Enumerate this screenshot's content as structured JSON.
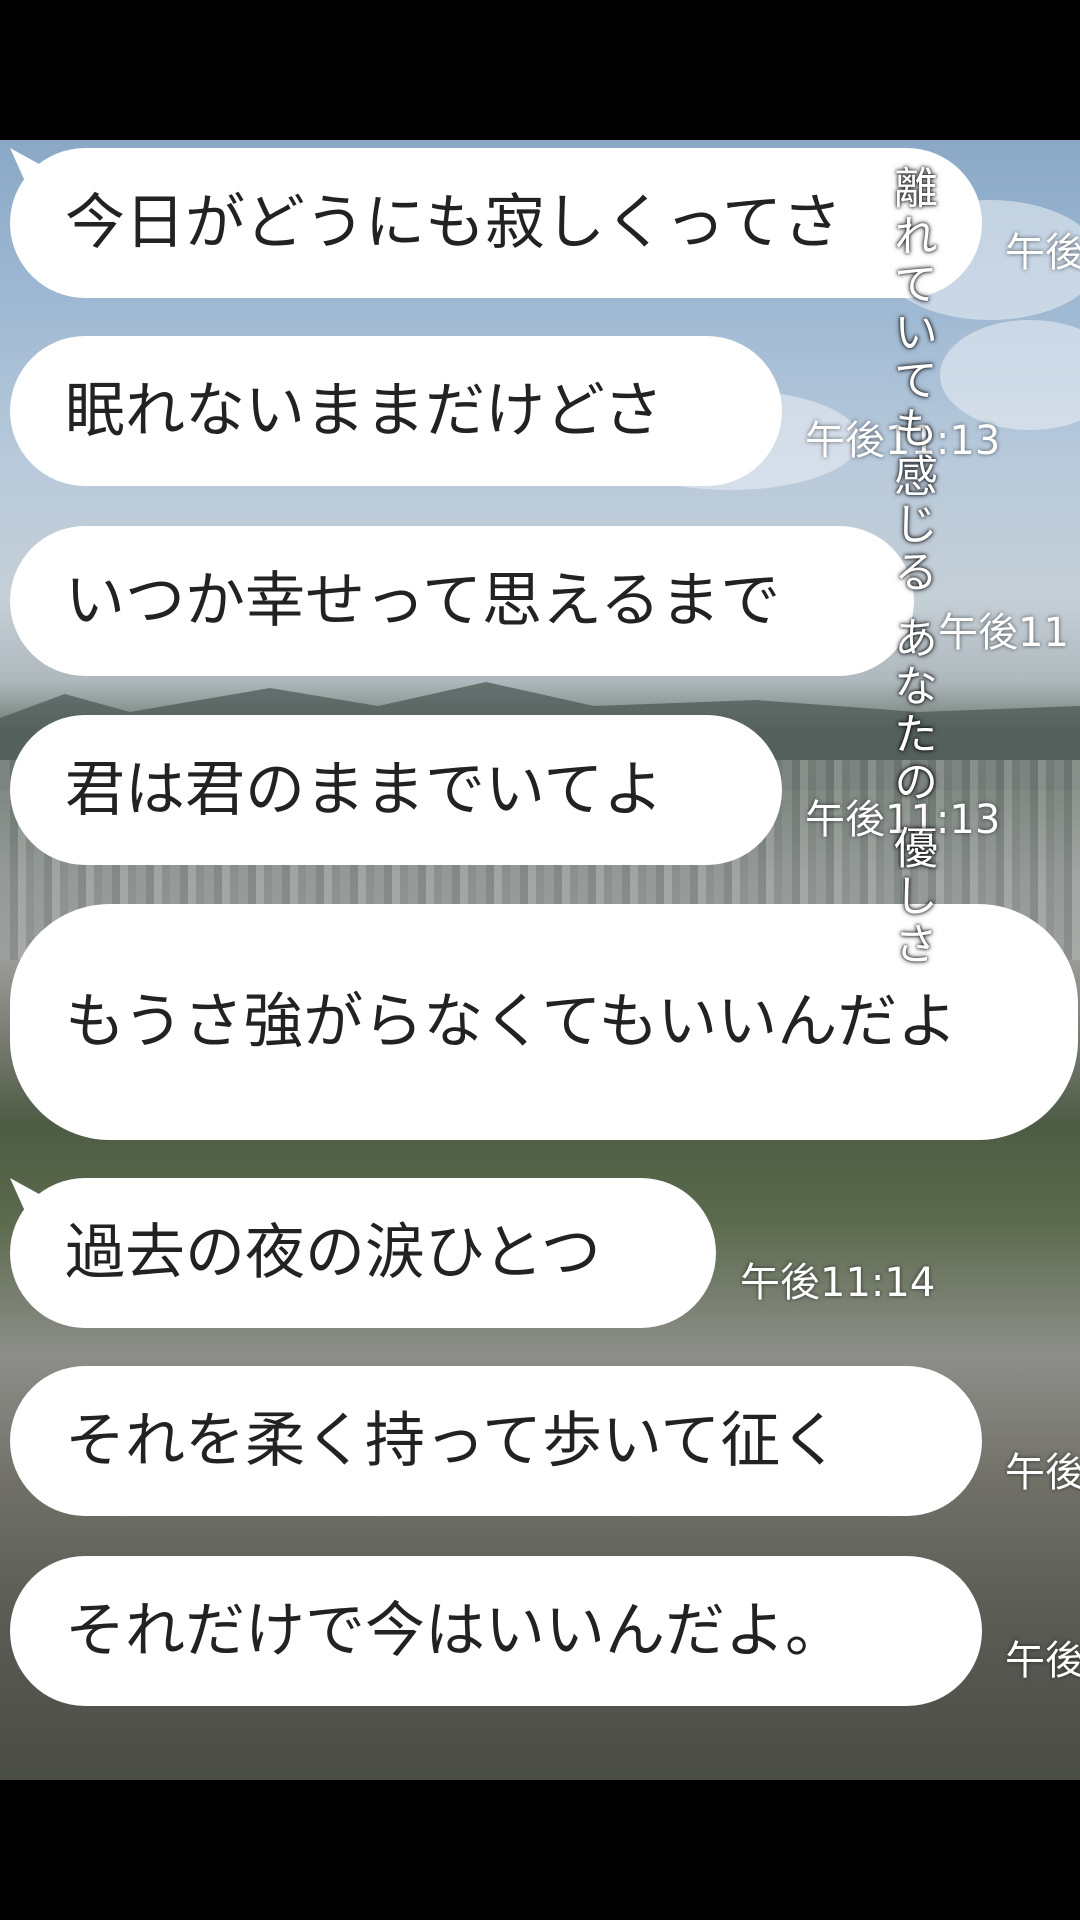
{
  "messages": [
    {
      "text": "今日がどうにも寂しくってさ",
      "time": "午後"
    },
    {
      "text": "眠れないままだけどさ",
      "time": "午後11:13"
    },
    {
      "text": "いつか幸せって思えるまで",
      "time": "午後11"
    },
    {
      "text": "君は君のままでいてよ",
      "time": "午後11:13"
    },
    {
      "text": "もうさ強がらなくてもいいんだよ",
      "time": ""
    },
    {
      "text": "過去の夜の涙ひとつ",
      "time": "午後11:14"
    },
    {
      "text": "それを柔く持って歩いて征く",
      "time": "午後"
    },
    {
      "text": "それだけで今はいいんだよ。",
      "time": "午後"
    }
  ],
  "lyric_overlay": "離れていても感じる あなたの 優しさ",
  "colors": {
    "bubble": "#ffffff",
    "text": "#222222",
    "letterbox": "#000000"
  }
}
